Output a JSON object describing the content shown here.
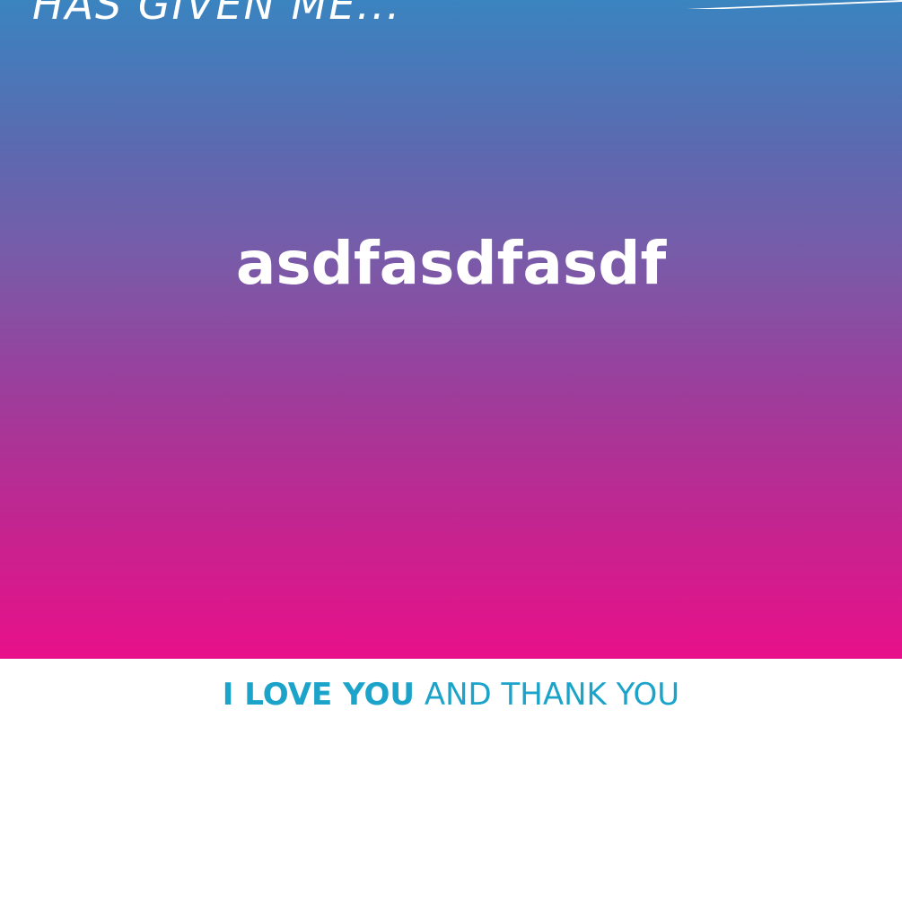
{
  "card": {
    "header_text": "HAS GIVEN ME...",
    "message": "asdfasdfasdf",
    "footer": {
      "bold_part": "I LOVE YOU",
      "regular_part": "AND THANK YOU"
    }
  },
  "colors": {
    "gradient_top": "#3a84c0",
    "gradient_bottom": "#e8108a",
    "footer_text": "#1ba3c9",
    "text_light": "#ffffff"
  }
}
